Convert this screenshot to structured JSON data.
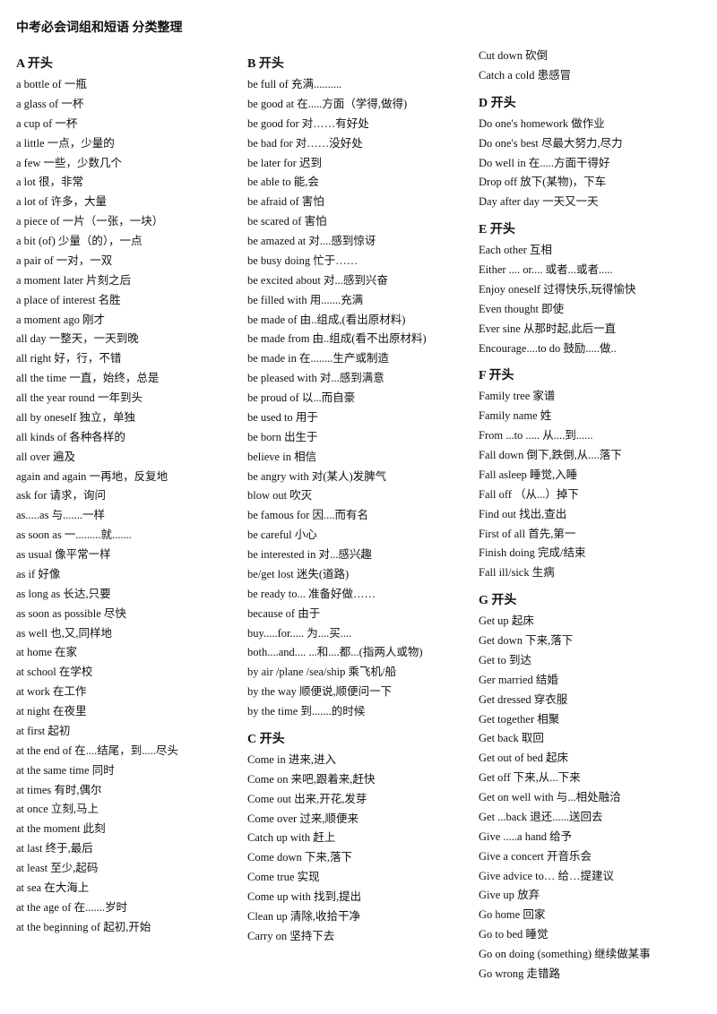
{
  "title": "中考必会词组和短语 分类整理",
  "columns": [
    {
      "sections": [
        {
          "header": "A 开头",
          "entries": [
            {
              "en": "a bottle of",
              "zh": "一瓶"
            },
            {
              "en": "a glass of",
              "zh": "一杯"
            },
            {
              "en": "a cup of",
              "zh": "一杯"
            },
            {
              "en": "a little",
              "zh": "一点，少量的"
            },
            {
              "en": "a few",
              "zh": "一些，少数几个"
            },
            {
              "en": "a lot",
              "zh": "很，非常"
            },
            {
              "en": "a lot of",
              "zh": "许多，大量"
            },
            {
              "en": "a piece of",
              "zh": "一片（一张，一块）"
            },
            {
              "en": "a bit (of)",
              "zh": "少量（的），一点"
            },
            {
              "en": "a pair of",
              "zh": "一对，一双"
            },
            {
              "en": "a moment later",
              "zh": "片刻之后"
            },
            {
              "en": "a place of interest",
              "zh": "名胜"
            },
            {
              "en": "a moment ago",
              "zh": "刚才"
            },
            {
              "en": "all day",
              "zh": "一整天，一天到晚"
            },
            {
              "en": "all right",
              "zh": "好，行，不错"
            },
            {
              "en": "all the time",
              "zh": "一直，始终，总是"
            },
            {
              "en": "all the year round",
              "zh": "一年到头"
            },
            {
              "en": "all by oneself",
              "zh": "独立，单独"
            },
            {
              "en": "all kinds of",
              "zh": "各种各样的"
            },
            {
              "en": "all over",
              "zh": "遍及"
            },
            {
              "en": "again and again",
              "zh": "一再地，反复地"
            },
            {
              "en": "ask for",
              "zh": "请求，询问"
            },
            {
              "en": "as.....as",
              "zh": "与.......一样"
            },
            {
              "en": "as soon as",
              "zh": "一.........就......."
            },
            {
              "en": "as usual",
              "zh": "像平常一样"
            },
            {
              "en": "as if",
              "zh": "好像"
            },
            {
              "en": "as long as",
              "zh": "长达,只要"
            },
            {
              "en": "as soon as possible",
              "zh": "尽快"
            },
            {
              "en": "as well",
              "zh": "也,又,同样地"
            },
            {
              "en": "at home",
              "zh": "在家"
            },
            {
              "en": "at school",
              "zh": "在学校"
            },
            {
              "en": "at work",
              "zh": "在工作"
            },
            {
              "en": "at night",
              "zh": "在夜里"
            },
            {
              "en": "at first",
              "zh": "起初"
            },
            {
              "en": "at the end of",
              "zh": "在....结尾，到.....尽头"
            },
            {
              "en": "at the same time",
              "zh": "同时"
            },
            {
              "en": "at times",
              "zh": "有时,偶尔"
            },
            {
              "en": "at once",
              "zh": "立刻,马上"
            },
            {
              "en": "at the moment",
              "zh": "此刻"
            },
            {
              "en": "at last",
              "zh": "终于,最后"
            },
            {
              "en": "at least",
              "zh": "至少,起码"
            },
            {
              "en": "at sea",
              "zh": "在大海上"
            },
            {
              "en": "at the age of",
              "zh": "在.......岁时"
            },
            {
              "en": "at the beginning of",
              "zh": "起初,开始"
            }
          ]
        }
      ]
    },
    {
      "sections": [
        {
          "header": "B 开头",
          "entries": [
            {
              "en": "be full of",
              "zh": "充满.........."
            },
            {
              "en": "be good at",
              "zh": "在.....方面（学得,做得)"
            },
            {
              "en": "be good for",
              "zh": "对……有好处"
            },
            {
              "en": "be bad for",
              "zh": "对……没好处"
            },
            {
              "en": "be later for",
              "zh": "迟到"
            },
            {
              "en": "be able to",
              "zh": "能,会"
            },
            {
              "en": "be afraid of",
              "zh": "害怕"
            },
            {
              "en": "be scared of",
              "zh": "害怕"
            },
            {
              "en": "be amazed at",
              "zh": "对....感到惊讶"
            },
            {
              "en": "be busy doing",
              "zh": "忙于……"
            },
            {
              "en": "be excited about",
              "zh": "对...感到兴奋"
            },
            {
              "en": "be filled with",
              "zh": "用.......充满"
            },
            {
              "en": "be made of",
              "zh": "由..组成,(看出原材料)"
            },
            {
              "en": "be made from",
              "zh": "由..组成(看不出原材料)"
            },
            {
              "en": "be made in",
              "zh": "在........生产或制造"
            },
            {
              "en": "be pleased with",
              "zh": "对...感到满意"
            },
            {
              "en": "be proud of",
              "zh": "以...而自豪"
            },
            {
              "en": "be used to",
              "zh": "用于"
            },
            {
              "en": "be born",
              "zh": "出生于"
            },
            {
              "en": "believe in",
              "zh": "相信"
            },
            {
              "en": "be angry with",
              "zh": "对(某人)发脾气"
            },
            {
              "en": "blow out",
              "zh": "吹灭"
            },
            {
              "en": "be famous for",
              "zh": "因....而有名"
            },
            {
              "en": "be careful",
              "zh": "小心"
            },
            {
              "en": "be interested in",
              "zh": "对...感兴趣"
            },
            {
              "en": "be/get lost",
              "zh": "迷失(道路)"
            },
            {
              "en": "be ready to...",
              "zh": "准备好做……"
            },
            {
              "en": "because of",
              "zh": "由于"
            },
            {
              "en": "buy.....for.....",
              "zh": "为....买...."
            },
            {
              "en": "both....and....",
              "zh": "...和....都...(指两人或物)"
            },
            {
              "en": "by air /plane /sea/ship",
              "zh": "乘飞机/船"
            },
            {
              "en": "by the way",
              "zh": "顺便说,顺便问一下"
            },
            {
              "en": "by the time",
              "zh": "到.......的时候"
            }
          ]
        },
        {
          "header": "C 开头",
          "entries": [
            {
              "en": "Come in",
              "zh": "进来,进入"
            },
            {
              "en": "Come on",
              "zh": "来吧,跟着来,赶快"
            },
            {
              "en": "Come out",
              "zh": "出来,开花,发芽"
            },
            {
              "en": "Come over",
              "zh": "过来,顺便来"
            },
            {
              "en": "Catch up with",
              "zh": "赶上"
            },
            {
              "en": "Come down",
              "zh": "下来,落下"
            },
            {
              "en": "Come true",
              "zh": "实现"
            },
            {
              "en": "Come up with",
              "zh": "找到,提出"
            },
            {
              "en": "Clean up",
              "zh": "清除,收拾干净"
            },
            {
              "en": "Carry on",
              "zh": "坚持下去"
            }
          ]
        }
      ]
    },
    {
      "sections": [
        {
          "header": "",
          "entries": [
            {
              "en": "Cut down",
              "zh": "砍倒"
            },
            {
              "en": "Catch a cold",
              "zh": "患感冒"
            }
          ]
        },
        {
          "header": "D 开头",
          "entries": [
            {
              "en": "Do one's homework",
              "zh": "做作业"
            },
            {
              "en": "Do one's best",
              "zh": "尽最大努力,尽力"
            },
            {
              "en": "Do well in",
              "zh": "在.....方面干得好"
            },
            {
              "en": "Drop off",
              "zh": "放下(某物)，下车"
            },
            {
              "en": "Day after day",
              "zh": "一天又一天"
            }
          ]
        },
        {
          "header": "E 开头",
          "entries": [
            {
              "en": "Each other",
              "zh": "互相"
            },
            {
              "en": "Either .... or....",
              "zh": "或者...或者....."
            },
            {
              "en": "Enjoy oneself",
              "zh": "过得快乐,玩得愉快"
            },
            {
              "en": "Even thought",
              "zh": "即使"
            },
            {
              "en": "Ever sine",
              "zh": "从那时起,此后一直"
            },
            {
              "en": "Encourage....to do",
              "zh": "鼓励.....做.."
            }
          ]
        },
        {
          "header": "F 开头",
          "entries": [
            {
              "en": "Family tree",
              "zh": "家谱"
            },
            {
              "en": "Family name",
              "zh": "姓"
            },
            {
              "en": "From ...to .....",
              "zh": "从....到......"
            },
            {
              "en": "Fall down",
              "zh": "倒下,跌倒,从....落下"
            },
            {
              "en": "Fall asleep",
              "zh": "睡觉,入睡"
            },
            {
              "en": "Fall off",
              "zh": "（从...）掉下"
            },
            {
              "en": "Find out",
              "zh": "找出,查出"
            },
            {
              "en": "First of all",
              "zh": "首先,第一"
            },
            {
              "en": "Finish doing",
              "zh": "完成/结束"
            },
            {
              "en": "Fall ill/sick",
              "zh": "生病"
            }
          ]
        },
        {
          "header": "G 开头",
          "entries": [
            {
              "en": "Get up",
              "zh": "起床"
            },
            {
              "en": "Get down",
              "zh": "下来,落下"
            },
            {
              "en": "Get to",
              "zh": "到达"
            },
            {
              "en": "Ger married",
              "zh": "结婚"
            },
            {
              "en": "Get dressed",
              "zh": "穿衣服"
            },
            {
              "en": "Get together",
              "zh": "相聚"
            },
            {
              "en": "Get back",
              "zh": "取回"
            },
            {
              "en": "Get out of bed",
              "zh": "起床"
            },
            {
              "en": "Get off",
              "zh": "下来,从...下来"
            },
            {
              "en": "Get on well with",
              "zh": "与...相处融洽"
            },
            {
              "en": "Get ...back",
              "zh": "退还......送回去"
            },
            {
              "en": "Give .....a hand",
              "zh": "给予"
            },
            {
              "en": "Give a concert",
              "zh": "开音乐会"
            },
            {
              "en": "Give advice to…",
              "zh": "给…提建议"
            },
            {
              "en": "Give up",
              "zh": "放弃"
            },
            {
              "en": "Go home",
              "zh": "回家"
            },
            {
              "en": "Go to bed",
              "zh": "睡觉"
            },
            {
              "en": "Go on doing (something)",
              "zh": "继续做某事"
            },
            {
              "en": "Go wrong",
              "zh": "走错路"
            }
          ]
        }
      ]
    }
  ]
}
